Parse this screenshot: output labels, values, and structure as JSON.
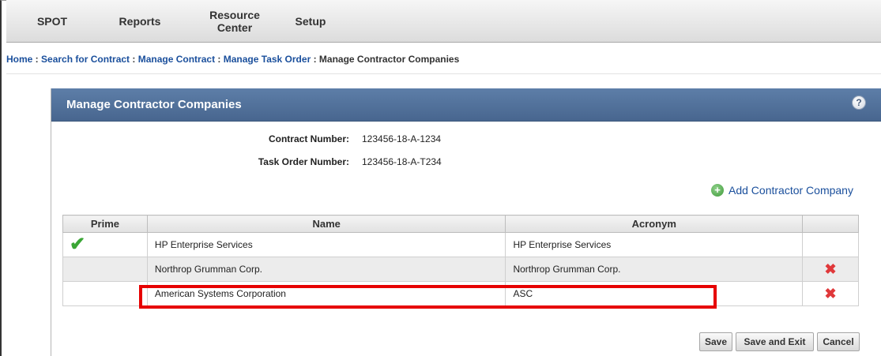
{
  "nav": {
    "items": [
      {
        "label_line1": "SPOT",
        "label_line2": ""
      },
      {
        "label_line1": "Reports",
        "label_line2": ""
      },
      {
        "label_line1": "Resource",
        "label_line2": "Center"
      },
      {
        "label_line1": "Setup",
        "label_line2": ""
      }
    ]
  },
  "breadcrumb": {
    "home": "Home",
    "search": "Search for Contract",
    "manage_contract": "Manage Contract",
    "manage_task_order": "Manage Task Order",
    "current": "Manage Contractor Companies",
    "separator": " : "
  },
  "panel": {
    "title": "Manage Contractor Companies",
    "help_glyph": "?",
    "contract_number_label": "Contract Number:",
    "contract_number": "123456-18-A-1234",
    "task_order_label": "Task Order Number:",
    "task_order_number": "123456-18-A-T234",
    "add_label": "Add Contractor Company",
    "add_glyph": "+"
  },
  "table": {
    "headers": {
      "prime": "Prime",
      "name": "Name",
      "acronym": "Acronym"
    },
    "rows": [
      {
        "prime": true,
        "name": "HP Enterprise Services",
        "acronym": "HP Enterprise Services",
        "deletable": false
      },
      {
        "prime": false,
        "name": "Northrop Grumman Corp.",
        "acronym": "Northrop Grumman Corp.",
        "deletable": true
      },
      {
        "prime": false,
        "name": "American Systems Corporation",
        "acronym": "ASC",
        "deletable": true
      }
    ],
    "check_glyph": "✔",
    "delete_glyph": "✖"
  },
  "buttons": {
    "save": "Save",
    "save_exit": "Save and Exit",
    "cancel": "Cancel"
  },
  "colors": {
    "header_blue": "#48668f",
    "link_blue": "#1a4f9c",
    "highlight_red": "#e60000",
    "check_green": "#3aa635",
    "delete_red": "#e0383a"
  }
}
